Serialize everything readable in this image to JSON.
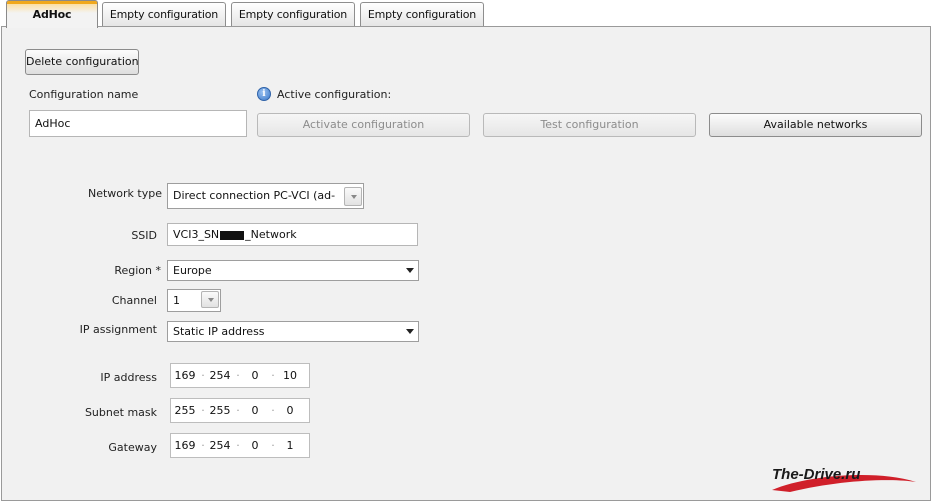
{
  "tabs": [
    {
      "label": "AdHoc",
      "active": true
    },
    {
      "label": "Empty configuration",
      "active": false
    },
    {
      "label": "Empty configuration",
      "active": false
    },
    {
      "label": "Empty configuration",
      "active": false
    }
  ],
  "toolbar": {
    "delete_label": "Delete configuration",
    "activate_label": "Activate configuration",
    "test_label": "Test configuration",
    "available_label": "Available networks"
  },
  "config": {
    "name_label": "Configuration name",
    "name_value": "AdHoc",
    "active_label": "Active configuration:"
  },
  "form": {
    "network_type_label": "Network type",
    "network_type_value": "Direct connection PC-VCI (ad-",
    "ssid_label": "SSID",
    "ssid_prefix": "VCI3_SN",
    "ssid_suffix": "_Network",
    "region_label": "Region *",
    "region_value": "Europe",
    "channel_label": "Channel",
    "channel_value": "1",
    "ip_assignment_label": "IP assignment",
    "ip_assignment_value": "Static IP address",
    "ip_address_label": "IP address",
    "ip_address": [
      "169",
      "254",
      "0",
      "10"
    ],
    "subnet_label": "Subnet mask",
    "subnet": [
      "255",
      "255",
      "0",
      "0"
    ],
    "gateway_label": "Gateway",
    "gateway": [
      "169",
      "254",
      "0",
      "1"
    ]
  },
  "watermark": {
    "text": "The-Drive.ru"
  },
  "icons": {
    "info": "info-icon",
    "dropdown": "chevron-down-icon"
  },
  "colors": {
    "tab_accent": "#f0a81c",
    "panel_bg": "#f1f1f1",
    "info_blue": "#3a78c9",
    "watermark_red": "#d0202a"
  }
}
